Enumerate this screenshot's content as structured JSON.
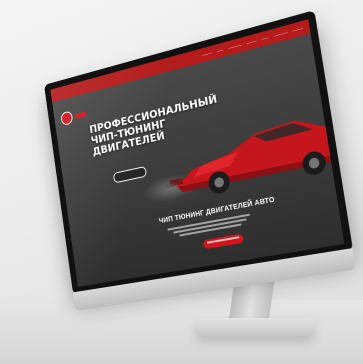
{
  "hero": {
    "title_lines": [
      "ПРОФЕССИОНАЛЬНЫЙ",
      "ЧИП-ТЮНИНГ",
      "ДВИГАТЕЛЕЙ"
    ],
    "subtitle": "ЧИП ТЮНИНГ ДВИГАТЕЛЕЙ АВТО"
  },
  "colors": {
    "brand_red": "#d3141c",
    "nav_red": "#b51b1b",
    "screen_dark": "#3a3a3a"
  },
  "icons": {
    "logo": "red-circle-logo",
    "car": "red-sports-car-illustration"
  }
}
